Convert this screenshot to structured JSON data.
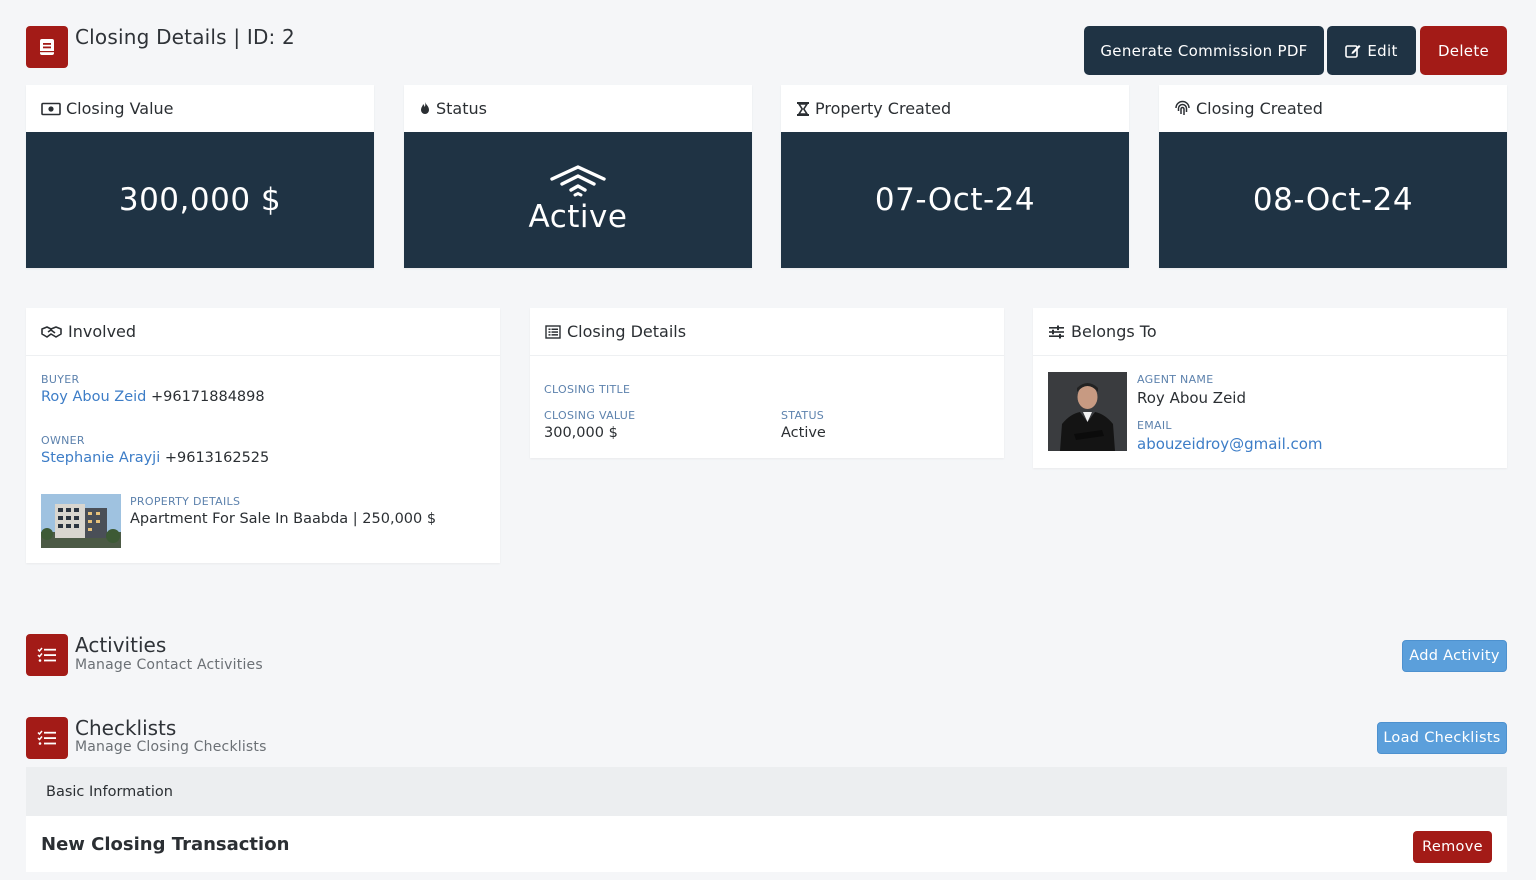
{
  "header": {
    "title": "Closing Details | ID: 2",
    "buttons": {
      "generate_pdf": "Generate Commission PDF",
      "edit": "Edit",
      "delete": "Delete"
    }
  },
  "stats": [
    {
      "label": "Closing Value",
      "value": "300,000 $",
      "icon": "money-icon"
    },
    {
      "label": "Status",
      "value": "Active",
      "icon": "flame-icon"
    },
    {
      "label": "Property Created",
      "value": "07-Oct-24",
      "icon": "hourglass-icon"
    },
    {
      "label": "Closing Created",
      "value": "08-Oct-24",
      "icon": "fingerprint-icon"
    }
  ],
  "involved": {
    "title": "Involved",
    "buyer_label": "BUYER",
    "buyer_name": "Roy Abou Zeid",
    "buyer_phone": "+96171884898",
    "owner_label": "OWNER",
    "owner_name": "Stephanie Arayji",
    "owner_phone": "+9613162525",
    "property_label": "PROPERTY DETAILS",
    "property_value": "Apartment For Sale In Baabda | 250,000 $"
  },
  "closing_details": {
    "title": "Closing Details",
    "closing_title_label": "CLOSING TITLE",
    "closing_value_label": "CLOSING VALUE",
    "closing_value": "300,000 $",
    "status_label": "STATUS",
    "status_value": "Active"
  },
  "belongs_to": {
    "title": "Belongs To",
    "agent_label": "AGENT NAME",
    "agent_name": "Roy Abou Zeid",
    "email_label": "EMAIL",
    "email": "abouzeidroy@gmail.com"
  },
  "activities": {
    "title": "Activities",
    "subtitle": "Manage Contact Activities",
    "button": "Add Activity"
  },
  "checklists": {
    "title": "Checklists",
    "subtitle": "Manage Closing Checklists",
    "button": "Load Checklists",
    "section": "Basic Information",
    "item_title": "New Closing Transaction",
    "remove": "Remove"
  },
  "colors": {
    "accent_red": "#a31b17",
    "dark_navy": "#1f3344",
    "blue_button": "#5b9fdb",
    "link_blue": "#3d7dc7"
  }
}
